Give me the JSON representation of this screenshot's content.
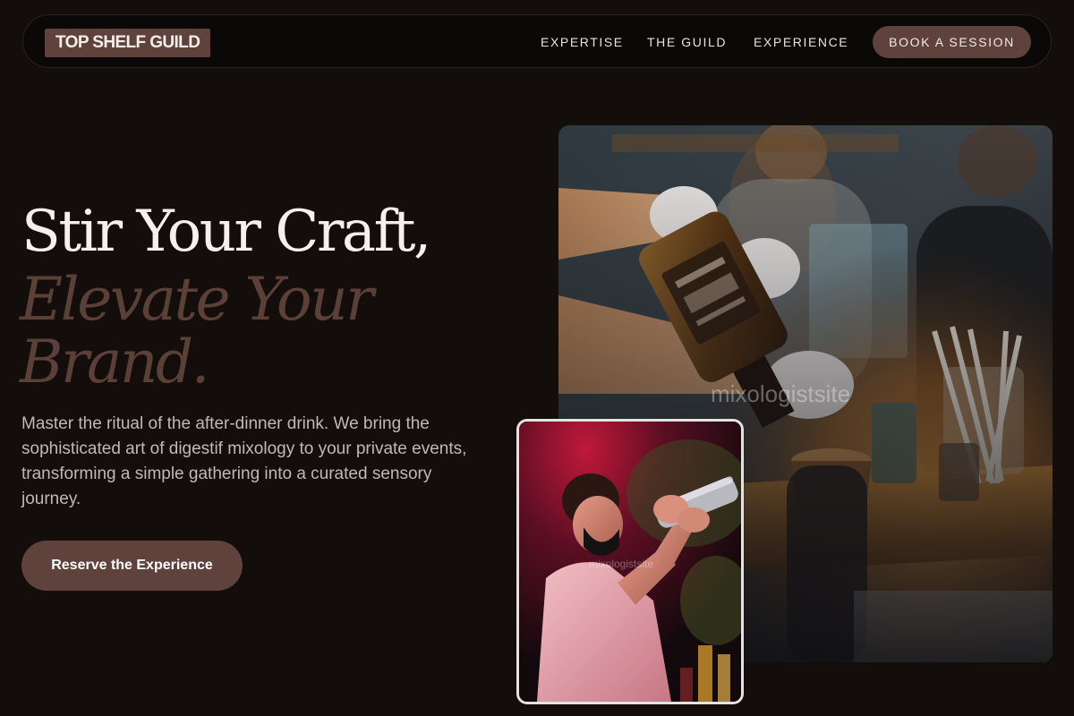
{
  "nav": {
    "logo": "TOP SHELF GUILD",
    "links": [
      {
        "label": "EXPERTISE"
      },
      {
        "label": "THE GUILD"
      },
      {
        "label": "EXPERIENCE"
      }
    ],
    "cta": "BOOK A SESSION"
  },
  "hero": {
    "line1": "Stir Your Craft,",
    "line2": "Elevate Your",
    "line3": "Brand.",
    "description": "Master the ritual of the after-dinner drink. We bring the sophisticated art of digestif mixology to your private events, transforming a simple gathering into a curated sensory journey.",
    "button": "Reserve the Experience"
  },
  "images": {
    "main_watermark": "mixologistsite",
    "inset_watermark": "mixologistsite"
  },
  "colors": {
    "background": "#130d0c",
    "accent": "#5e423b",
    "heading": "#f6f0ec",
    "heading_italic": "#5b4038",
    "body_text": "#c0b9b6"
  }
}
